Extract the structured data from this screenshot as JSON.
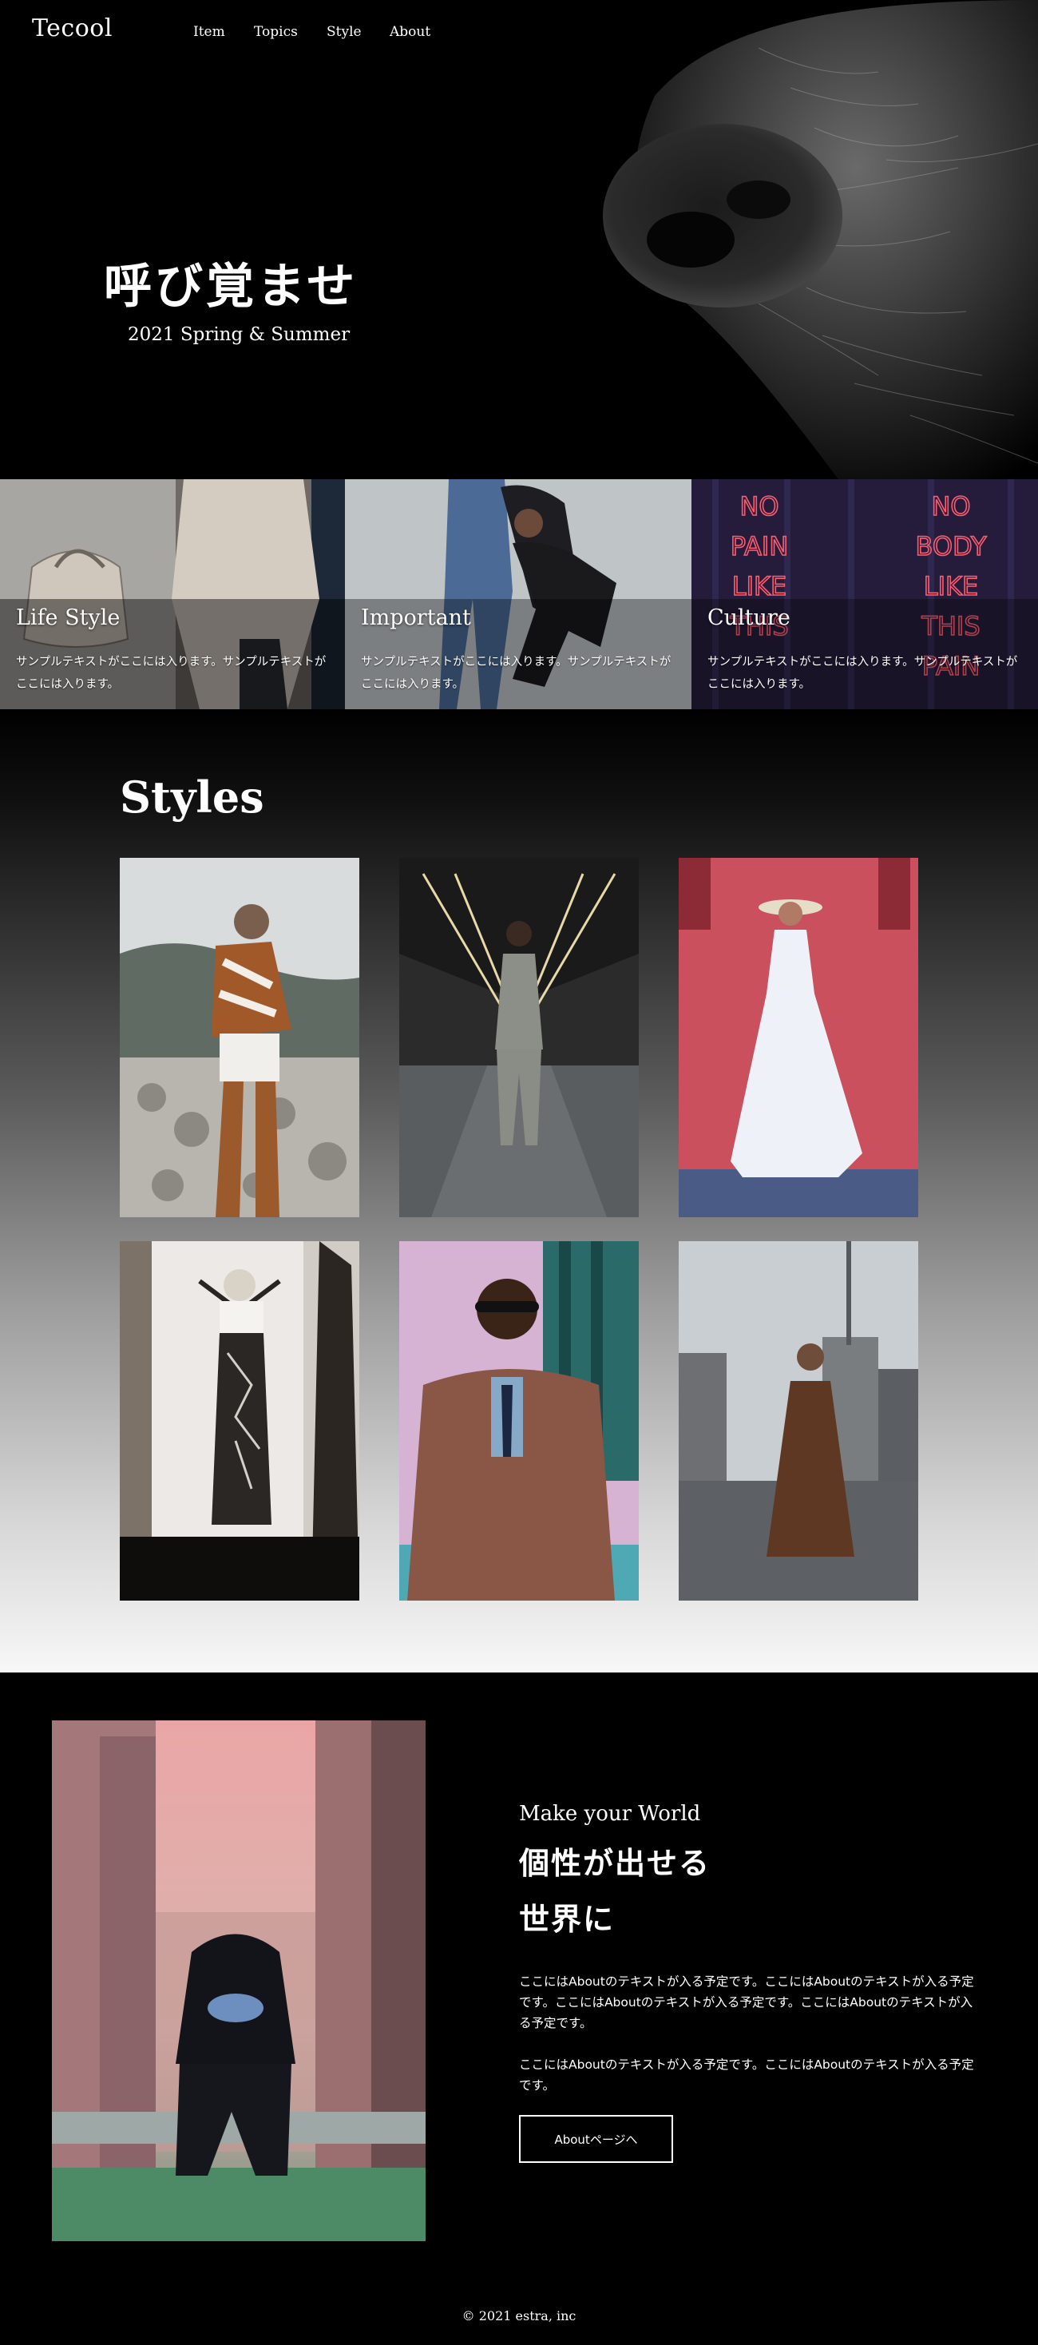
{
  "header": {
    "logo": "Tecool",
    "nav": [
      "Item",
      "Topics",
      "Style",
      "About"
    ]
  },
  "hero": {
    "title": "呼び覚ませ",
    "subtitle": "2021 Spring & Summer"
  },
  "categories": [
    {
      "title": "Life Style",
      "text": "サンプルテキストがここには入ります。サンプルテキストがここには入ります。"
    },
    {
      "title": "Important",
      "text": "サンプルテキストがここには入ります。サンプルテキストがここには入ります。"
    },
    {
      "title": "Culture",
      "text": "サンプルテキストがここには入ります。サンプルテキストがここには入ります。"
    }
  ],
  "neon": {
    "left": [
      "NO",
      "PAIN",
      "LIKE",
      "THIS"
    ],
    "right": [
      "NO",
      "BODY",
      "LIKE",
      "THIS",
      "PAIN"
    ]
  },
  "styles": {
    "title": "Styles"
  },
  "about": {
    "kicker": "Make your World",
    "title_line1": "個性が出せる",
    "title_line2": "世界に",
    "paragraph1": "ここにはAboutのテキストが入る予定です。ここにはAboutのテキストが入る予定です。ここにはAboutのテキストが入る予定です。ここにはAboutのテキストが入る予定です。",
    "paragraph2": "ここにはAboutのテキストが入る予定です。ここにはAboutのテキストが入る予定です。",
    "button": "Aboutページへ"
  },
  "footer": {
    "copyright": "© 2021 estra, inc"
  }
}
